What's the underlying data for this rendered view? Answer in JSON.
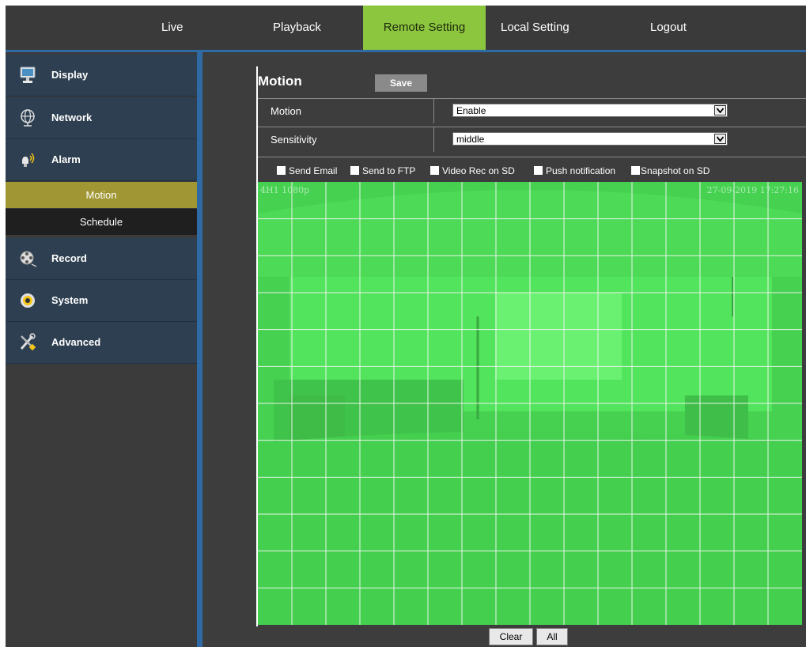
{
  "nav": {
    "live": "Live",
    "playback": "Playback",
    "remote_setting": "Remote Setting",
    "local_setting": "Local Setting",
    "logout": "Logout",
    "active": "Remote Setting"
  },
  "sidebar": {
    "items": [
      {
        "label": "Display",
        "icon": "monitor-icon"
      },
      {
        "label": "Network",
        "icon": "globe-icon"
      },
      {
        "label": "Alarm",
        "icon": "alarm-icon"
      },
      {
        "label": "Record",
        "icon": "film-reel-icon"
      },
      {
        "label": "System",
        "icon": "gear-icon"
      },
      {
        "label": "Advanced",
        "icon": "tools-icon"
      }
    ],
    "alarm_sub": {
      "motion": "Motion",
      "schedule": "Schedule",
      "active": "Motion"
    }
  },
  "main": {
    "title": "Motion",
    "save_label": "Save",
    "rows": {
      "motion_label": "Motion",
      "motion_value": "Enable",
      "sensitivity_label": "Sensitivity",
      "sensitivity_value": "middle"
    },
    "checkboxes": {
      "send_email": "Send Email",
      "send_ftp": "Send to FTP",
      "video_rec_sd": "Video Rec on SD",
      "push_notification": "Push notification",
      "snapshot_sd": "Snapshot on SD"
    },
    "video": {
      "channel_label": "4H1 1080p",
      "timestamp": "27-09-2019 17:27:16",
      "grid_columns": 16,
      "grid_rows": 12
    },
    "clear_label": "Clear",
    "all_label": "All"
  },
  "colors": {
    "active_tab": "#8cc63f",
    "sidebar_item_bg": "#2d3f50",
    "sub_active": "#a09634",
    "motion_overlay": "#35e34c",
    "accent_line": "#2f6aa5"
  }
}
